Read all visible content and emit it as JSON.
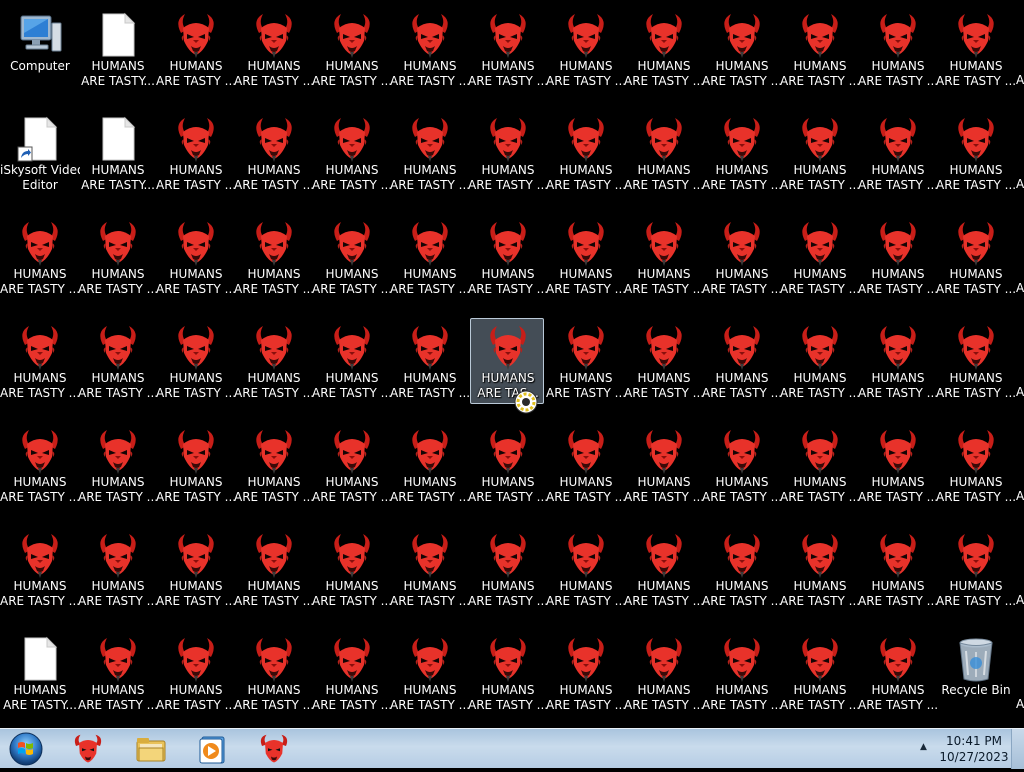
{
  "desktop": {
    "icon_rows": 7,
    "icon_cols": 13,
    "colors": {
      "background": "#000000",
      "demon_red": "#e8322a",
      "demon_dark": "#8a0f0c"
    },
    "special_icons": [
      {
        "row": 0,
        "col": 0,
        "type": "computer",
        "label_line1": "Computer",
        "label_line2": ""
      },
      {
        "row": 0,
        "col": 1,
        "type": "document",
        "label_line1": "HUMANS",
        "label_line2": "ARE TASTY..."
      },
      {
        "row": 1,
        "col": 0,
        "type": "shortcut",
        "label_line1": "iSkysoft Video",
        "label_line2": "Editor"
      },
      {
        "row": 1,
        "col": 1,
        "type": "document",
        "label_line1": "HUMANS",
        "label_line2": "ARE TASTY..."
      },
      {
        "row": 6,
        "col": 0,
        "type": "document",
        "label_line1": "HUMANS",
        "label_line2": "ARE TASTY..."
      },
      {
        "row": 6,
        "col": 12,
        "type": "recycle-bin",
        "label_line1": "Recycle Bin",
        "label_line2": ""
      }
    ],
    "selected_icon": {
      "row": 3,
      "col": 6,
      "label_line1": "HUMANS",
      "label_line2": "ARE TAS..."
    },
    "default_icon": {
      "type": "demon",
      "label_line1": "HUMANS",
      "label_line2": "ARE TASTY ..."
    },
    "edge_fragment": "A"
  },
  "taskbar": {
    "start_icon": "windows-orb-icon",
    "pinned": [
      {
        "name": "taskbar-demon-1",
        "icon": "demon-icon"
      },
      {
        "name": "taskbar-explorer",
        "icon": "folder-icon"
      },
      {
        "name": "taskbar-media-player",
        "icon": "media-player-icon"
      },
      {
        "name": "taskbar-demon-2",
        "icon": "demon-icon"
      }
    ],
    "tray_arrow": "▲",
    "time": "10:41 PM",
    "date": "10/27/2023"
  }
}
